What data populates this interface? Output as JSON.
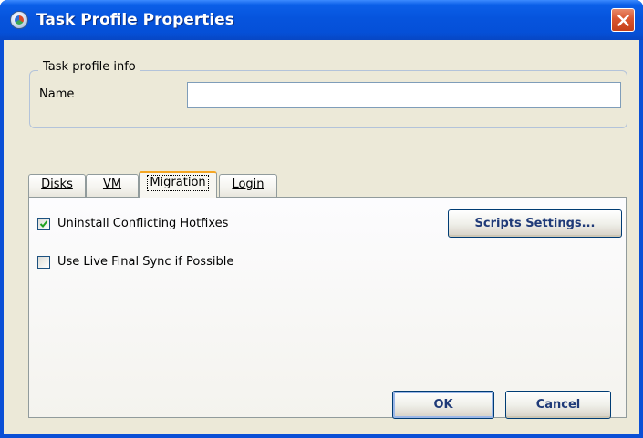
{
  "window": {
    "title": "Task Profile Properties"
  },
  "group": {
    "legend": "Task profile info",
    "name_label": "Name",
    "name_value": ""
  },
  "tabs": [
    {
      "label": "Disks",
      "active": false
    },
    {
      "label": "VM",
      "active": false
    },
    {
      "label": "Migration",
      "active": true
    },
    {
      "label": "Login",
      "active": false
    }
  ],
  "migration": {
    "uninstall_hotfixes_label": "Uninstall Conflicting Hotfixes",
    "uninstall_hotfixes_checked": true,
    "live_sync_label": "Use Live Final Sync if Possible",
    "live_sync_checked": false,
    "scripts_button_label": "Scripts Settings..."
  },
  "footer": {
    "ok_label": "OK",
    "cancel_label": "Cancel"
  },
  "colors": {
    "titlebar": "#0654dd",
    "close_button": "#d9552f",
    "dialog_background": "#ece9d8",
    "active_tab_accent": "#f5a623",
    "button_text": "#1f3a78"
  },
  "icons": {
    "title": "app-globe-icon",
    "close": "close-icon",
    "check": "checkmark-icon"
  }
}
